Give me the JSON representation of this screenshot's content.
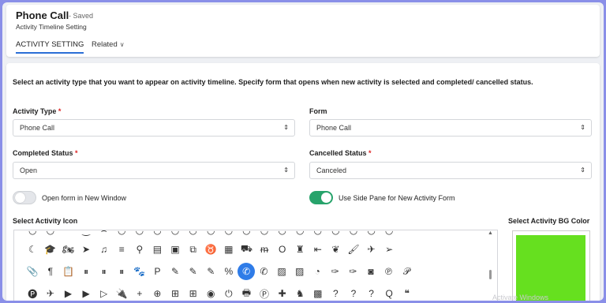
{
  "header": {
    "title": "Phone Call",
    "saved": "- Saved",
    "subtitle": "Activity Timeline Setting",
    "tabs": [
      {
        "label": "ACTIVITY SETTING",
        "active": true
      },
      {
        "label": "Related",
        "icon": "chevron-down-icon"
      }
    ]
  },
  "form": {
    "intro": "Select an activity type that you want to appear on activity timeline. Specify form that opens when new activity is selected and completed/ cancelled status.",
    "activity_type": {
      "label": "Activity Type",
      "required": "*",
      "value": "Phone Call"
    },
    "form_field": {
      "label": "Form",
      "value": "Phone Call"
    },
    "completed_status": {
      "label": "Completed Status",
      "required": "*",
      "value": "Open"
    },
    "cancelled_status": {
      "label": "Cancelled Status",
      "required": "*",
      "value": "Canceled"
    },
    "select_arrow": "⇕",
    "open_new_window": {
      "label": "Open form in New Window",
      "on": false
    },
    "side_pane": {
      "label": "Use Side Pane for New Activity Form",
      "on": true
    },
    "icon_label": "Select Activity Icon",
    "bg_label": "Select Activity BG Color",
    "bg_color": "#66e01f",
    "accent": "#2f7ce8",
    "toggle_on_color": "#27a36b"
  },
  "icons": {
    "row1": [
      "moon-icon",
      "graduation-cap-icon",
      "motorcycle-icon",
      "mouse-pointer-icon",
      "music-icon",
      "menu-icon",
      "map-pin-icon",
      "newspaper-icon",
      "object-group-icon",
      "object-ungroup-icon",
      "odnoklassniki-icon",
      "odnoklassniki-square-icon",
      "opencart-icon",
      "openid-icon",
      "opera-icon",
      "optin-monster-icon",
      "outdent-icon",
      "pagelines-icon",
      "paint-brush-icon",
      "paper-plane-icon",
      "paper-plane-outline-icon"
    ],
    "row1_glyphs": [
      "☾",
      "🎓",
      "🏍",
      "➤",
      "♫",
      "≡",
      "⚲",
      "▤",
      "▣",
      "⧉",
      "♉",
      "▦",
      "⛟",
      "ᵯ",
      "O",
      "♜",
      "⇤",
      "❦",
      "🖌",
      "✈",
      "➢"
    ],
    "row2": [
      "paperclip-icon",
      "paragraph-icon",
      "paste-icon",
      "pause-icon",
      "pause-circle-icon",
      "pause-circle-outline-icon",
      "paw-icon",
      "paypal-icon",
      "pencil-icon",
      "pencil-square-icon",
      "pencil-square-outline-icon",
      "percent-icon",
      "phone-icon",
      "phone-square-icon",
      "photo-icon",
      "picture-icon",
      "pie-chart-icon",
      "pied-piper-icon",
      "pied-piper-alt-icon",
      "pied-piper-pp-icon",
      "pinterest-icon",
      "pinterest-p-icon"
    ],
    "row2_glyphs": [
      "📎",
      "¶",
      "📋",
      "⏸",
      "⏸",
      "⏸",
      "🐾",
      "P",
      "✎",
      "✎",
      "✎",
      "%",
      "✆",
      "✆",
      "▨",
      "▨",
      "◔",
      "✑",
      "✑",
      "◙",
      "℗",
      "𝒫"
    ],
    "row2_selected": 12,
    "row3": [
      "pinterest-square-icon",
      "plane-icon",
      "play-icon",
      "play-circle-icon",
      "play-circle-outline-icon",
      "plug-icon",
      "plus-icon",
      "plus-circle-icon",
      "plus-square-icon",
      "plus-square-outline-icon",
      "podcast-icon",
      "power-off-icon",
      "print-icon",
      "product-hunt-icon",
      "puzzle-piece-icon",
      "qq-icon",
      "qrcode-icon",
      "question-icon",
      "question-circle-icon",
      "question-circle-outline-icon",
      "quora-icon",
      "quote-left-icon"
    ],
    "row3_glyphs": [
      "🅟",
      "✈",
      "▶",
      "▶",
      "▷",
      "🔌",
      "+",
      "⊕",
      "⊞",
      "⊞",
      "◉",
      "⏻",
      "🖶",
      "Ⓟ",
      "✚",
      "♞",
      "▩",
      "?",
      "?",
      "?",
      "Q",
      "❝"
    ],
    "row0_glyphs": [
      "◡",
      "◡",
      "⌒",
      "‿",
      "⌢",
      "◡",
      "◡",
      "◡",
      "◡",
      "◡",
      "◡",
      "◡",
      "◡",
      "◡",
      "◡",
      "◡",
      "◡",
      "◡",
      "◡",
      "◡",
      "◡"
    ]
  },
  "watermark": "Activate Windows"
}
